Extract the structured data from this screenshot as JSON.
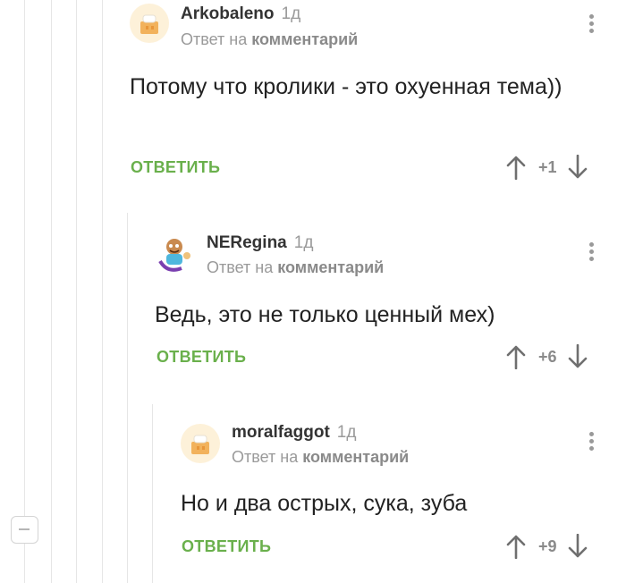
{
  "comments": [
    {
      "author": "Arkobaleno",
      "time": "1д",
      "reply_prefix": "Ответ на",
      "reply_target": "комментарий",
      "text": "Потому что кролики - это охуенная тема))",
      "reply_label": "ОТВЕТИТЬ",
      "rating": "+1"
    },
    {
      "author": "NERegina",
      "time": "1д",
      "reply_prefix": "Ответ на",
      "reply_target": "комментарий",
      "text": "Ведь, это не только ценный мех)",
      "reply_label": "ОТВЕТИТЬ",
      "rating": "+6"
    },
    {
      "author": "moralfaggot",
      "time": "1д",
      "reply_prefix": "Ответ на",
      "reply_target": "комментарий",
      "text": "Но и два острых, сука, зуба",
      "reply_label": "ОТВЕТИТЬ",
      "rating": "+9"
    }
  ],
  "colors": {
    "accent": "#6ab04c",
    "muted": "#9a9a9a",
    "thread_line": "#e6e6e6"
  },
  "icons": [
    "collapse-thread-icon",
    "upvote-arrow-icon",
    "downvote-arrow-icon",
    "more-options-icon",
    "avatar-placeholder-icon"
  ]
}
